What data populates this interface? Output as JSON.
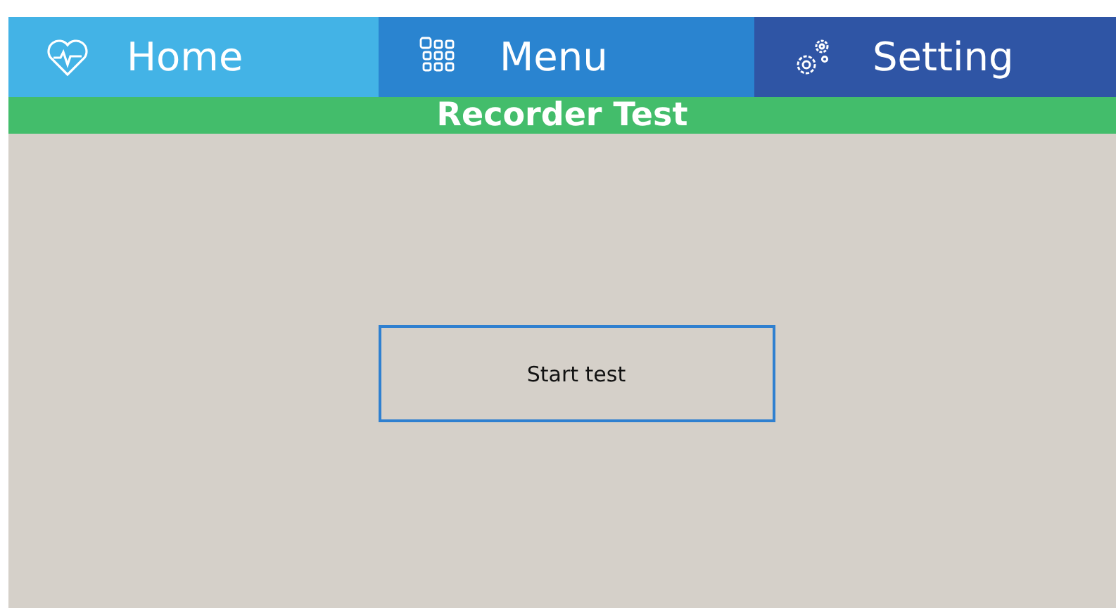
{
  "tabs": [
    {
      "label": "Home",
      "kind": "heart",
      "color": "#43b3e6"
    },
    {
      "label": "Menu",
      "kind": "grid",
      "color": "#2a84d0"
    },
    {
      "label": "Setting",
      "kind": "gears",
      "color": "#2f55a5"
    }
  ],
  "title": "Recorder Test",
  "button": "Start test"
}
